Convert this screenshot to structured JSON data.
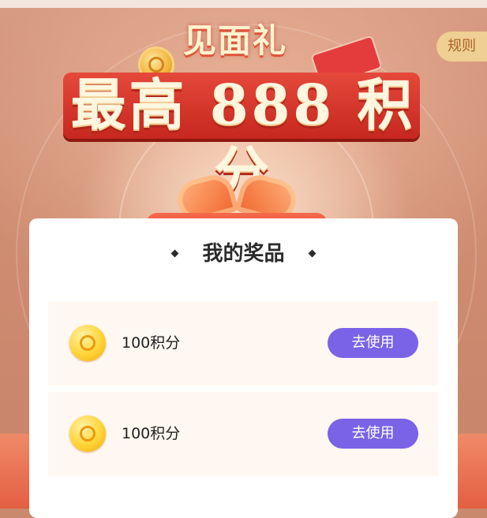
{
  "banner": {
    "subtitle": "见面礼",
    "headline": "最高 888 积分",
    "rules_label": "规则"
  },
  "prizes": {
    "title": "我的奖品",
    "items": [
      {
        "label": "100积分",
        "button": "去使用"
      },
      {
        "label": "100积分",
        "button": "去使用"
      }
    ]
  },
  "colors": {
    "accent_button": "#7a63e6",
    "banner_red": "#d4322a",
    "row_background": "#fff7f1"
  },
  "icons": {
    "prize": "gold-coin-icon",
    "emblem": "coin-emblem-icon"
  }
}
